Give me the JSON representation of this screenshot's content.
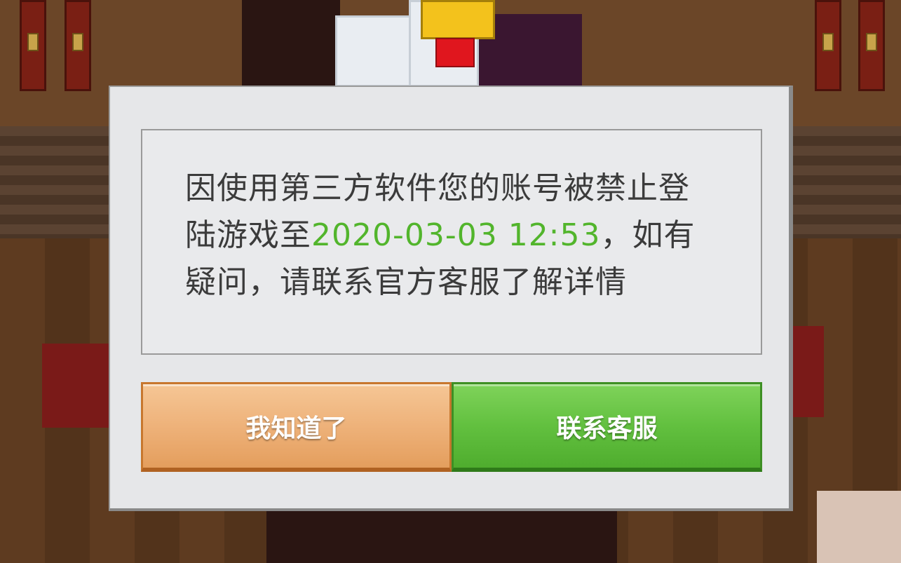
{
  "dialog": {
    "message_before": "因使用第三方软件您的账号被禁止登陆游戏至",
    "ban_until": "2020-03-03 12:53",
    "message_after": "，如有疑问，请联系官方客服了解详情",
    "ok_label": "我知道了",
    "contact_label": "联系客服"
  },
  "colors": {
    "highlight": "#52b52c",
    "ok_button": "#eeb27a",
    "contact_button": "#62c03f",
    "dialog_bg": "#e6e7e9"
  },
  "icons": {
    "mascot": "chicken-mascot-icon"
  }
}
